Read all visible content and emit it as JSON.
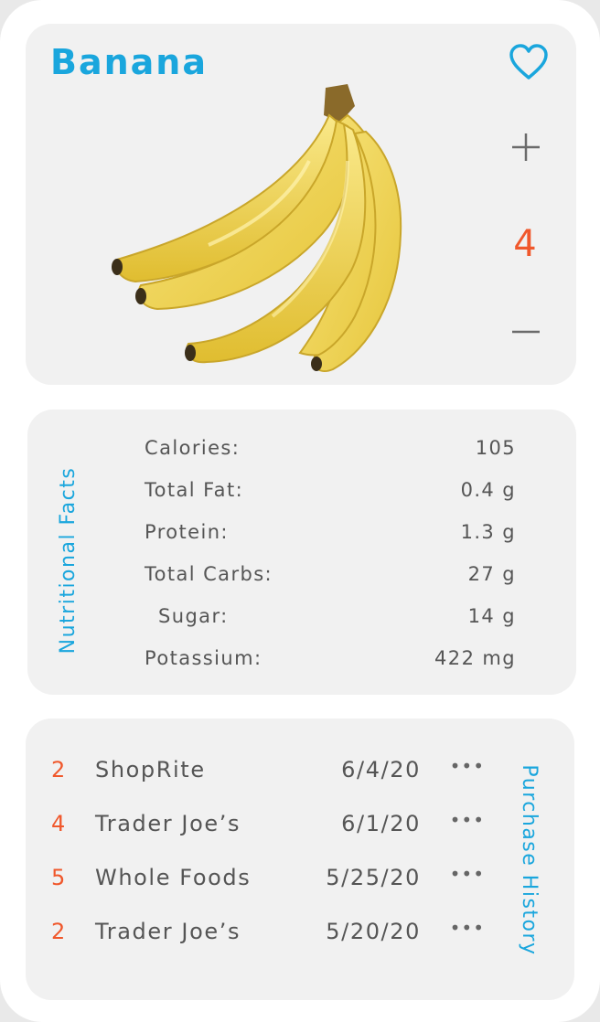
{
  "product": {
    "name": "Banana",
    "quantity": "4",
    "image_alt": "bunch of yellow bananas",
    "colors": {
      "title": "#1aa6dd",
      "accent": "#f0582c"
    },
    "icons": {
      "favorite": "heart-icon",
      "increment": "plus-icon",
      "decrement": "minus-icon"
    }
  },
  "nutrition": {
    "title": "Nutritional Facts",
    "rows": [
      {
        "label": "Calories:",
        "value": "105"
      },
      {
        "label": "Total Fat:",
        "value": "0.4 g"
      },
      {
        "label": "Protein:",
        "value": "1.3 g"
      },
      {
        "label": "Total Carbs:",
        "value": "27 g"
      },
      {
        "label": "Sugar:",
        "value": "14 g"
      },
      {
        "label": "Potassium:",
        "value": "422 mg"
      }
    ]
  },
  "purchase_history": {
    "title": "Purchase History",
    "rows": [
      {
        "qty": "2",
        "store": "ShopRite",
        "date": "6/4/20",
        "more": "•••"
      },
      {
        "qty": "4",
        "store": "Trader Joe’s",
        "date": "6/1/20",
        "more": "•••"
      },
      {
        "qty": "5",
        "store": "Whole Foods",
        "date": "5/25/20",
        "more": "•••"
      },
      {
        "qty": "2",
        "store": "Trader Joe’s",
        "date": "5/20/20",
        "more": "•••"
      }
    ]
  }
}
